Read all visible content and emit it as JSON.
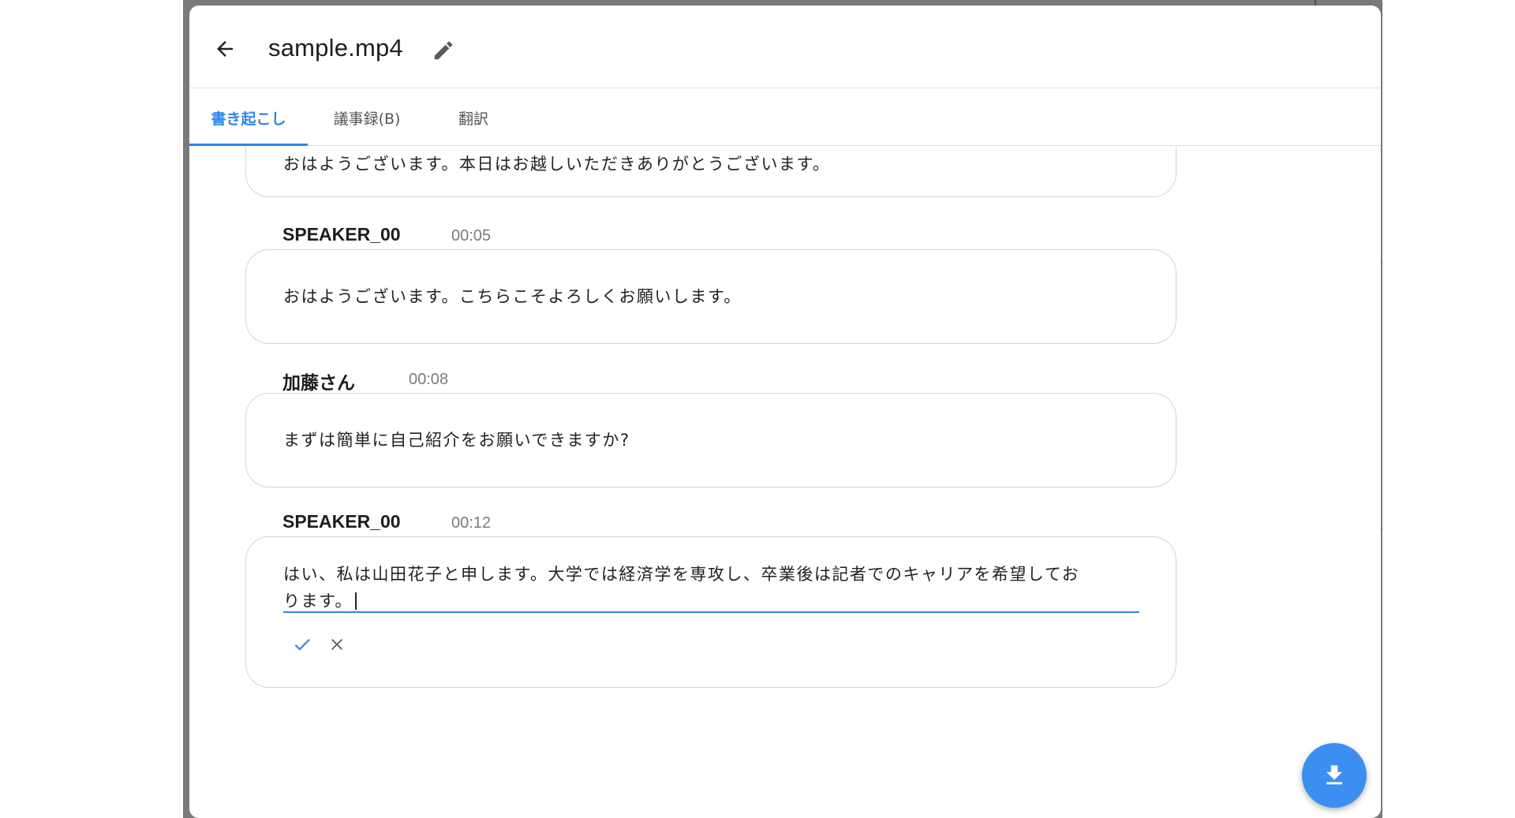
{
  "dialog": {
    "title": "sample.mp4"
  },
  "tabs": [
    {
      "label": "書き起こし",
      "active": true
    },
    {
      "label": "議事録(B)",
      "active": false
    },
    {
      "label": "翻訳",
      "active": false
    }
  ],
  "transcript": {
    "partial_entry_text": "おはようございます。本日はお越しいただきありがとうございます。",
    "entries": [
      {
        "speaker": "SPEAKER_00",
        "time": "00:05",
        "text": "おはようございます。こちらこそよろしくお願いします。"
      },
      {
        "speaker": "加藤さん",
        "time": "00:08",
        "text": "まずは簡単に自己紹介をお願いできますか?"
      },
      {
        "speaker": "SPEAKER_00",
        "time": "00:12",
        "text_line1": "はい、私は山田花子と申します。大学では経済学を専攻し、卒業後は記者でのキャリアを希望してお",
        "text_line2": "ります。",
        "editing": true
      }
    ]
  },
  "colors": {
    "accent": "#2f86e9",
    "fab": "#3c8ff0"
  },
  "icons": {
    "back": "arrow-left-icon",
    "edit": "pencil-icon",
    "confirm": "check-icon",
    "cancel": "close-icon",
    "download": "download-icon"
  }
}
